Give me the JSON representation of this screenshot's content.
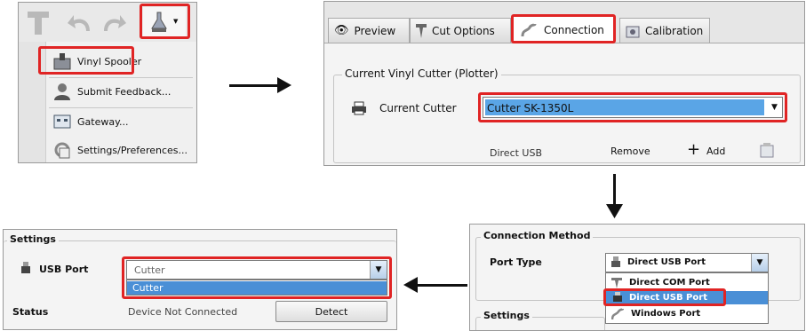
{
  "menu": {
    "items": [
      {
        "label": "Vinyl Spooler",
        "icon": "vinyl-spooler-icon"
      },
      {
        "label": "Submit Feedback...",
        "icon": "feedback-icon"
      },
      {
        "label": "Gateway...",
        "icon": "gateway-icon"
      },
      {
        "label": "Settings/Preferences...",
        "icon": "settings-icon"
      }
    ]
  },
  "vinyl_window": {
    "tabs": [
      {
        "label": "Preview",
        "icon": "eye-icon"
      },
      {
        "label": "Cut Options",
        "icon": "cut-icon"
      },
      {
        "label": "Connection",
        "icon": "connection-icon"
      },
      {
        "label": "Calibration",
        "icon": "calibration-icon"
      }
    ],
    "group_title": "Current Vinyl Cutter (Plotter)",
    "current_cutter_label": "Current Cutter",
    "current_cutter_value": "Cutter SK-1350L",
    "port_label": "Direct USB",
    "remove_label": "Remove",
    "add_label": "Add"
  },
  "connection_method": {
    "title": "Connection Method",
    "port_type_label": "Port Type",
    "port_type_value": "Direct USB Port",
    "options": [
      "Direct COM Port",
      "Direct USB Port",
      "Windows Port"
    ],
    "settings_title": "Settings"
  },
  "settings_panel": {
    "title": "Settings",
    "usb_port_label": "USB Port",
    "usb_port_value": "Cutter",
    "usb_port_options": [
      "Cutter"
    ],
    "status_label": "Status",
    "status_value": "Device Not Connected",
    "detect_label": "Detect"
  },
  "colors": {
    "highlight": "#e02424",
    "selection": "#3a8dde"
  }
}
